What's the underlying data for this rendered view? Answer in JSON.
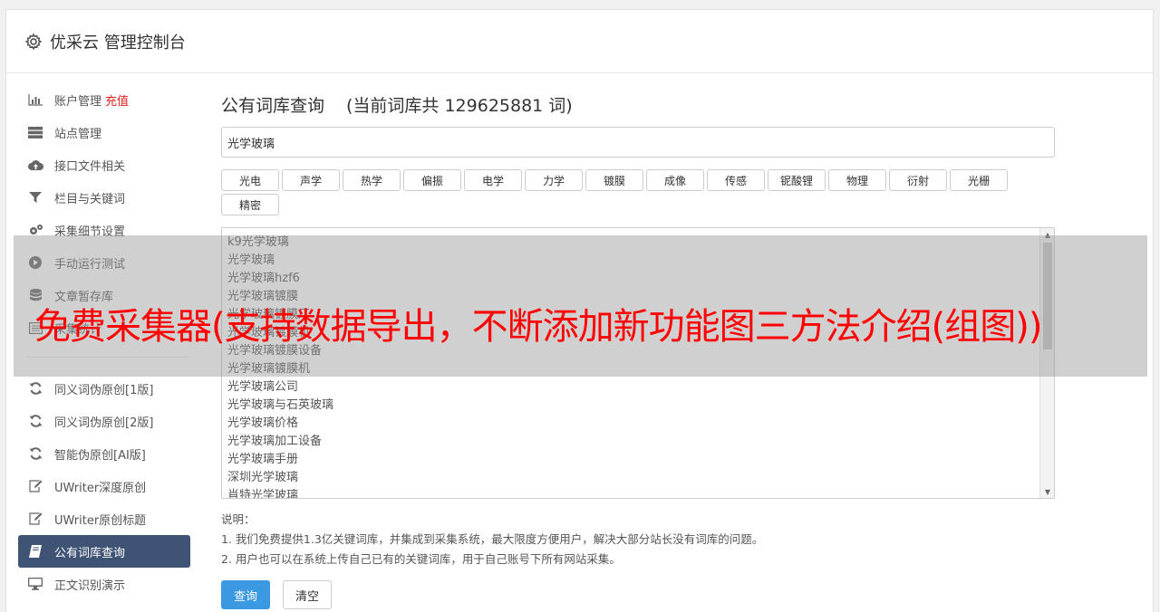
{
  "app": {
    "title": "优采云 管理控制台"
  },
  "sidebar": {
    "items": [
      {
        "label": "账户管理",
        "badge": "充值",
        "icon": "bar-chart-icon"
      },
      {
        "label": "站点管理",
        "icon": "server-icon"
      },
      {
        "label": "接口文件相关",
        "icon": "cloud-upload-icon"
      },
      {
        "label": "栏目与关键词",
        "icon": "filter-icon"
      },
      {
        "label": "采集细节设置",
        "icon": "gears-icon"
      },
      {
        "label": "手动运行测试",
        "icon": "play-icon"
      },
      {
        "label": "文章暂存库",
        "icon": "database-icon"
      },
      {
        "label": "采集统计",
        "icon": "list-icon"
      }
    ],
    "items2": [
      {
        "label": "同义词伪原创[1版]",
        "icon": "refresh-icon"
      },
      {
        "label": "同义词伪原创[2版]",
        "icon": "refresh-icon"
      },
      {
        "label": "智能伪原创[AI版]",
        "icon": "refresh-icon"
      },
      {
        "label": "UWriter深度原创",
        "icon": "edit-icon"
      },
      {
        "label": "UWriter原创标题",
        "icon": "edit-icon"
      },
      {
        "label": "公有词库查询",
        "icon": "book-icon",
        "active": true
      },
      {
        "label": "正文识别演示",
        "icon": "desktop-icon"
      }
    ]
  },
  "main": {
    "heading": "公有词库查询",
    "count_text": "(当前词库共 129625881 词)",
    "search_value": "光学玻璃",
    "tags": [
      "光电",
      "声学",
      "热学",
      "偏振",
      "电学",
      "力学",
      "镀膜",
      "成像",
      "传感",
      "铌酸锂",
      "物理",
      "衍射",
      "光栅",
      "精密"
    ],
    "results": [
      "k9光学玻璃",
      "光学玻璃",
      "光学玻璃hzf6",
      "光学玻璃镀膜",
      "光学玻璃镀膜厂",
      "光学玻璃镀膜机",
      "光学玻璃镀膜设备",
      "光学玻璃镀膜机",
      "光学玻璃公司",
      "光学玻璃与石英玻璃",
      "光学玻璃价格",
      "光学玻璃加工设备",
      "光学玻璃手册",
      "深圳光学玻璃",
      "肖特光学玻璃"
    ],
    "notes_title": "说明：",
    "notes": [
      "1. 我们免费提供1.3亿关键词库，并集成到采集系统，最大限度方便用户，解决大部分站长没有词库的问题。",
      "2. 用户也可以在系统上传自己已有的关键词库，用于自己账号下所有网站采集。"
    ],
    "query_button": "查询",
    "clear_button": "清空"
  },
  "overlay": {
    "text": "免费采集器(支持数据导出，不断添加新功能图三方法介绍(组图))"
  },
  "colors": {
    "active_bg": "#3f5375",
    "primary": "#3a99e0",
    "badge": "#e02020",
    "overlay_text": "#ff0000"
  }
}
